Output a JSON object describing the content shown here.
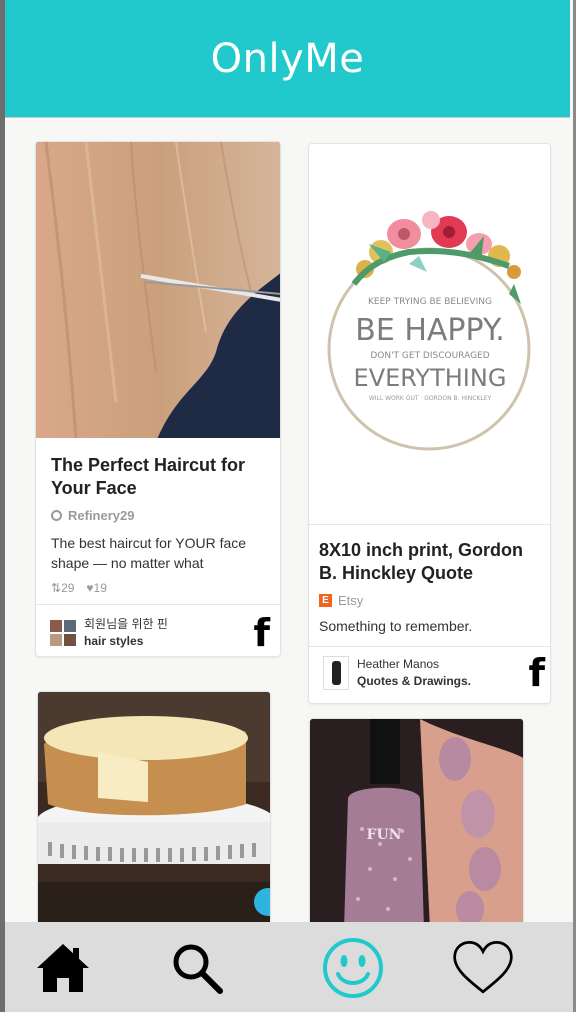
{
  "app": {
    "title": "OnlyMe"
  },
  "pins": [
    {
      "title": "The Perfect Haircut for Your Face",
      "source": "Refinery29",
      "description": "The best haircut for YOUR face shape — no matter what",
      "repins": "29",
      "likes": "19",
      "pinner_name": "회원님을 위한 핀",
      "board": "hair styles",
      "share_icon": "facebook-icon"
    },
    {
      "title": "8X10 inch print, Gordon B. Hinckley Quote",
      "source": "Etsy",
      "description": "Something to remember.",
      "pinner_name": "Heather Manos",
      "board": "Quotes & Drawings.",
      "share_icon": "facebook-icon",
      "image_text": {
        "line1": "KEEP TRYING BE BELIEVING",
        "line2": "BE HAPPY.",
        "line3": "DON'T GET DISCOURAGED",
        "line4": "EVERYTHING",
        "line5": "WILL WORK OUT · GORDON B. HINCKLEY"
      }
    },
    {
      "image": "cheesecake"
    },
    {
      "image": "glitter-nail-polish",
      "bottle_label": "FUN"
    }
  ],
  "nav": {
    "items": [
      {
        "icon": "home-icon"
      },
      {
        "icon": "search-icon"
      },
      {
        "icon": "smiley-icon",
        "active": true
      },
      {
        "icon": "heart-icon"
      }
    ],
    "active_color": "#21c9cc"
  },
  "colors": {
    "header": "#21c9cc",
    "nav_bar": "#dcdcdc"
  }
}
